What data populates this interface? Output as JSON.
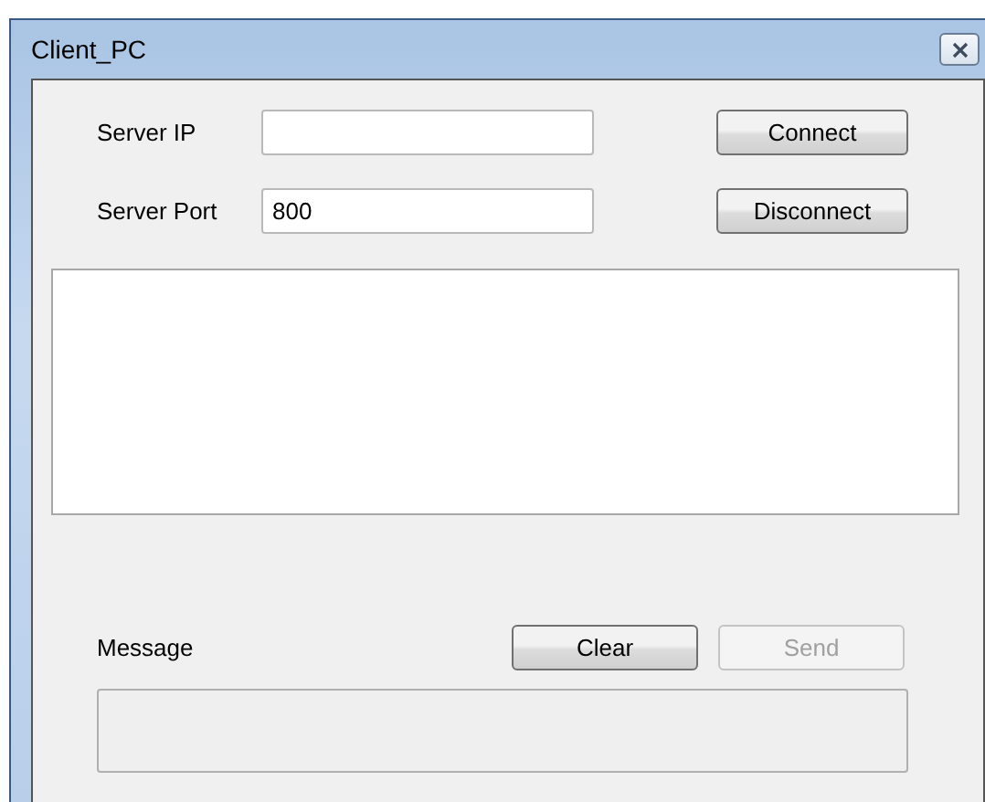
{
  "window": {
    "title": "Client_PC"
  },
  "server_ip": {
    "label": "Server IP"
  },
  "server_port": {
    "label": "Server Port",
    "value": "800"
  },
  "buttons": [
    {
      "label": "Connect",
      "disabled": false
    },
    {
      "label": "Disconnect",
      "disabled": false
    },
    {
      "label": "Clear",
      "disabled": false
    },
    {
      "label": "Send",
      "disabled": true
    }
  ],
  "message": {
    "label": "Message",
    "disabled": true
  }
}
